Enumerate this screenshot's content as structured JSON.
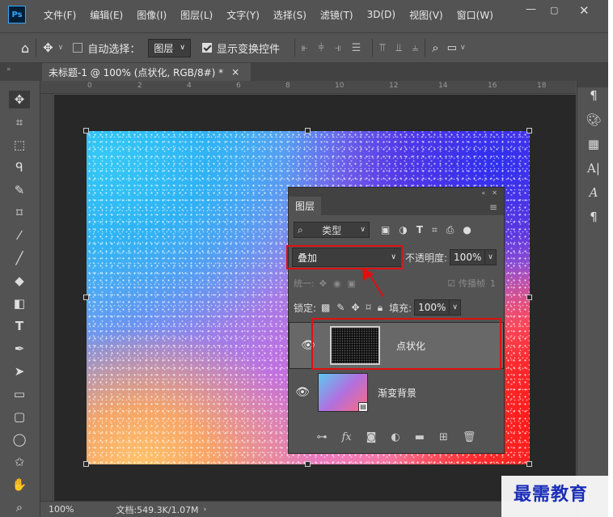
{
  "app": {
    "logo": "Ps",
    "brand_color": "#31a8ff"
  },
  "menubar": {
    "items": [
      "文件(F)",
      "编辑(E)",
      "图像(I)",
      "图层(L)",
      "文字(Y)",
      "选择(S)",
      "滤镜(T)",
      "3D(D)",
      "视图(V)",
      "窗口(W)"
    ],
    "window_controls": [
      "minimize-icon",
      "restore-icon",
      "close-icon"
    ]
  },
  "options_bar": {
    "auto_select_label": "自动选择：",
    "auto_select_checked": false,
    "auto_select_target": "图层",
    "show_transform_label": "显示变换控件",
    "show_transform_checked": true
  },
  "document_tab": {
    "title": "未标题-1 @ 100% (点状化, RGB/8#) *",
    "close": "×"
  },
  "ruler": {
    "ticks": [
      "0",
      "2",
      "4",
      "6",
      "8",
      "10",
      "12",
      "14",
      "16",
      "18"
    ]
  },
  "left_tools": [
    "move-icon",
    "artboard-icon",
    "marquee-icon",
    "lasso-icon",
    "quick-select-icon",
    "crop-icon",
    "eyedropper-icon",
    "brush-icon",
    "eraser-icon",
    "gradient-icon",
    "type-icon",
    "pen-icon",
    "path-select-icon",
    "rectangle-icon",
    "rounded-rect-icon",
    "ellipse-icon",
    "custom-shape-icon",
    "hand-icon",
    "zoom-icon"
  ],
  "right_tools": [
    "character-paragraph-icon",
    "color-palette-icon",
    "swatches-grid-icon",
    "character-icon",
    "glyphs-icon",
    "paragraph-icon"
  ],
  "layers_panel": {
    "title": "图层",
    "filter_label": "类型",
    "blend_mode": "叠加",
    "opacity_label": "不透明度:",
    "opacity_value": "100%",
    "unify_label": "统一:",
    "propagate_label": "传播帧",
    "propagate_value": "1",
    "lock_label": "锁定:",
    "fill_label": "填充:",
    "fill_value": "100%",
    "layers": [
      {
        "name": "点状化",
        "visible": true,
        "selected": true
      },
      {
        "name": "渐变背景",
        "visible": true,
        "selected": false
      }
    ]
  },
  "status_bar": {
    "zoom": "100%",
    "doc_info": "文档:549.3K/1.07M"
  },
  "watermark": "最需教育",
  "annotation_color": "#e01010"
}
